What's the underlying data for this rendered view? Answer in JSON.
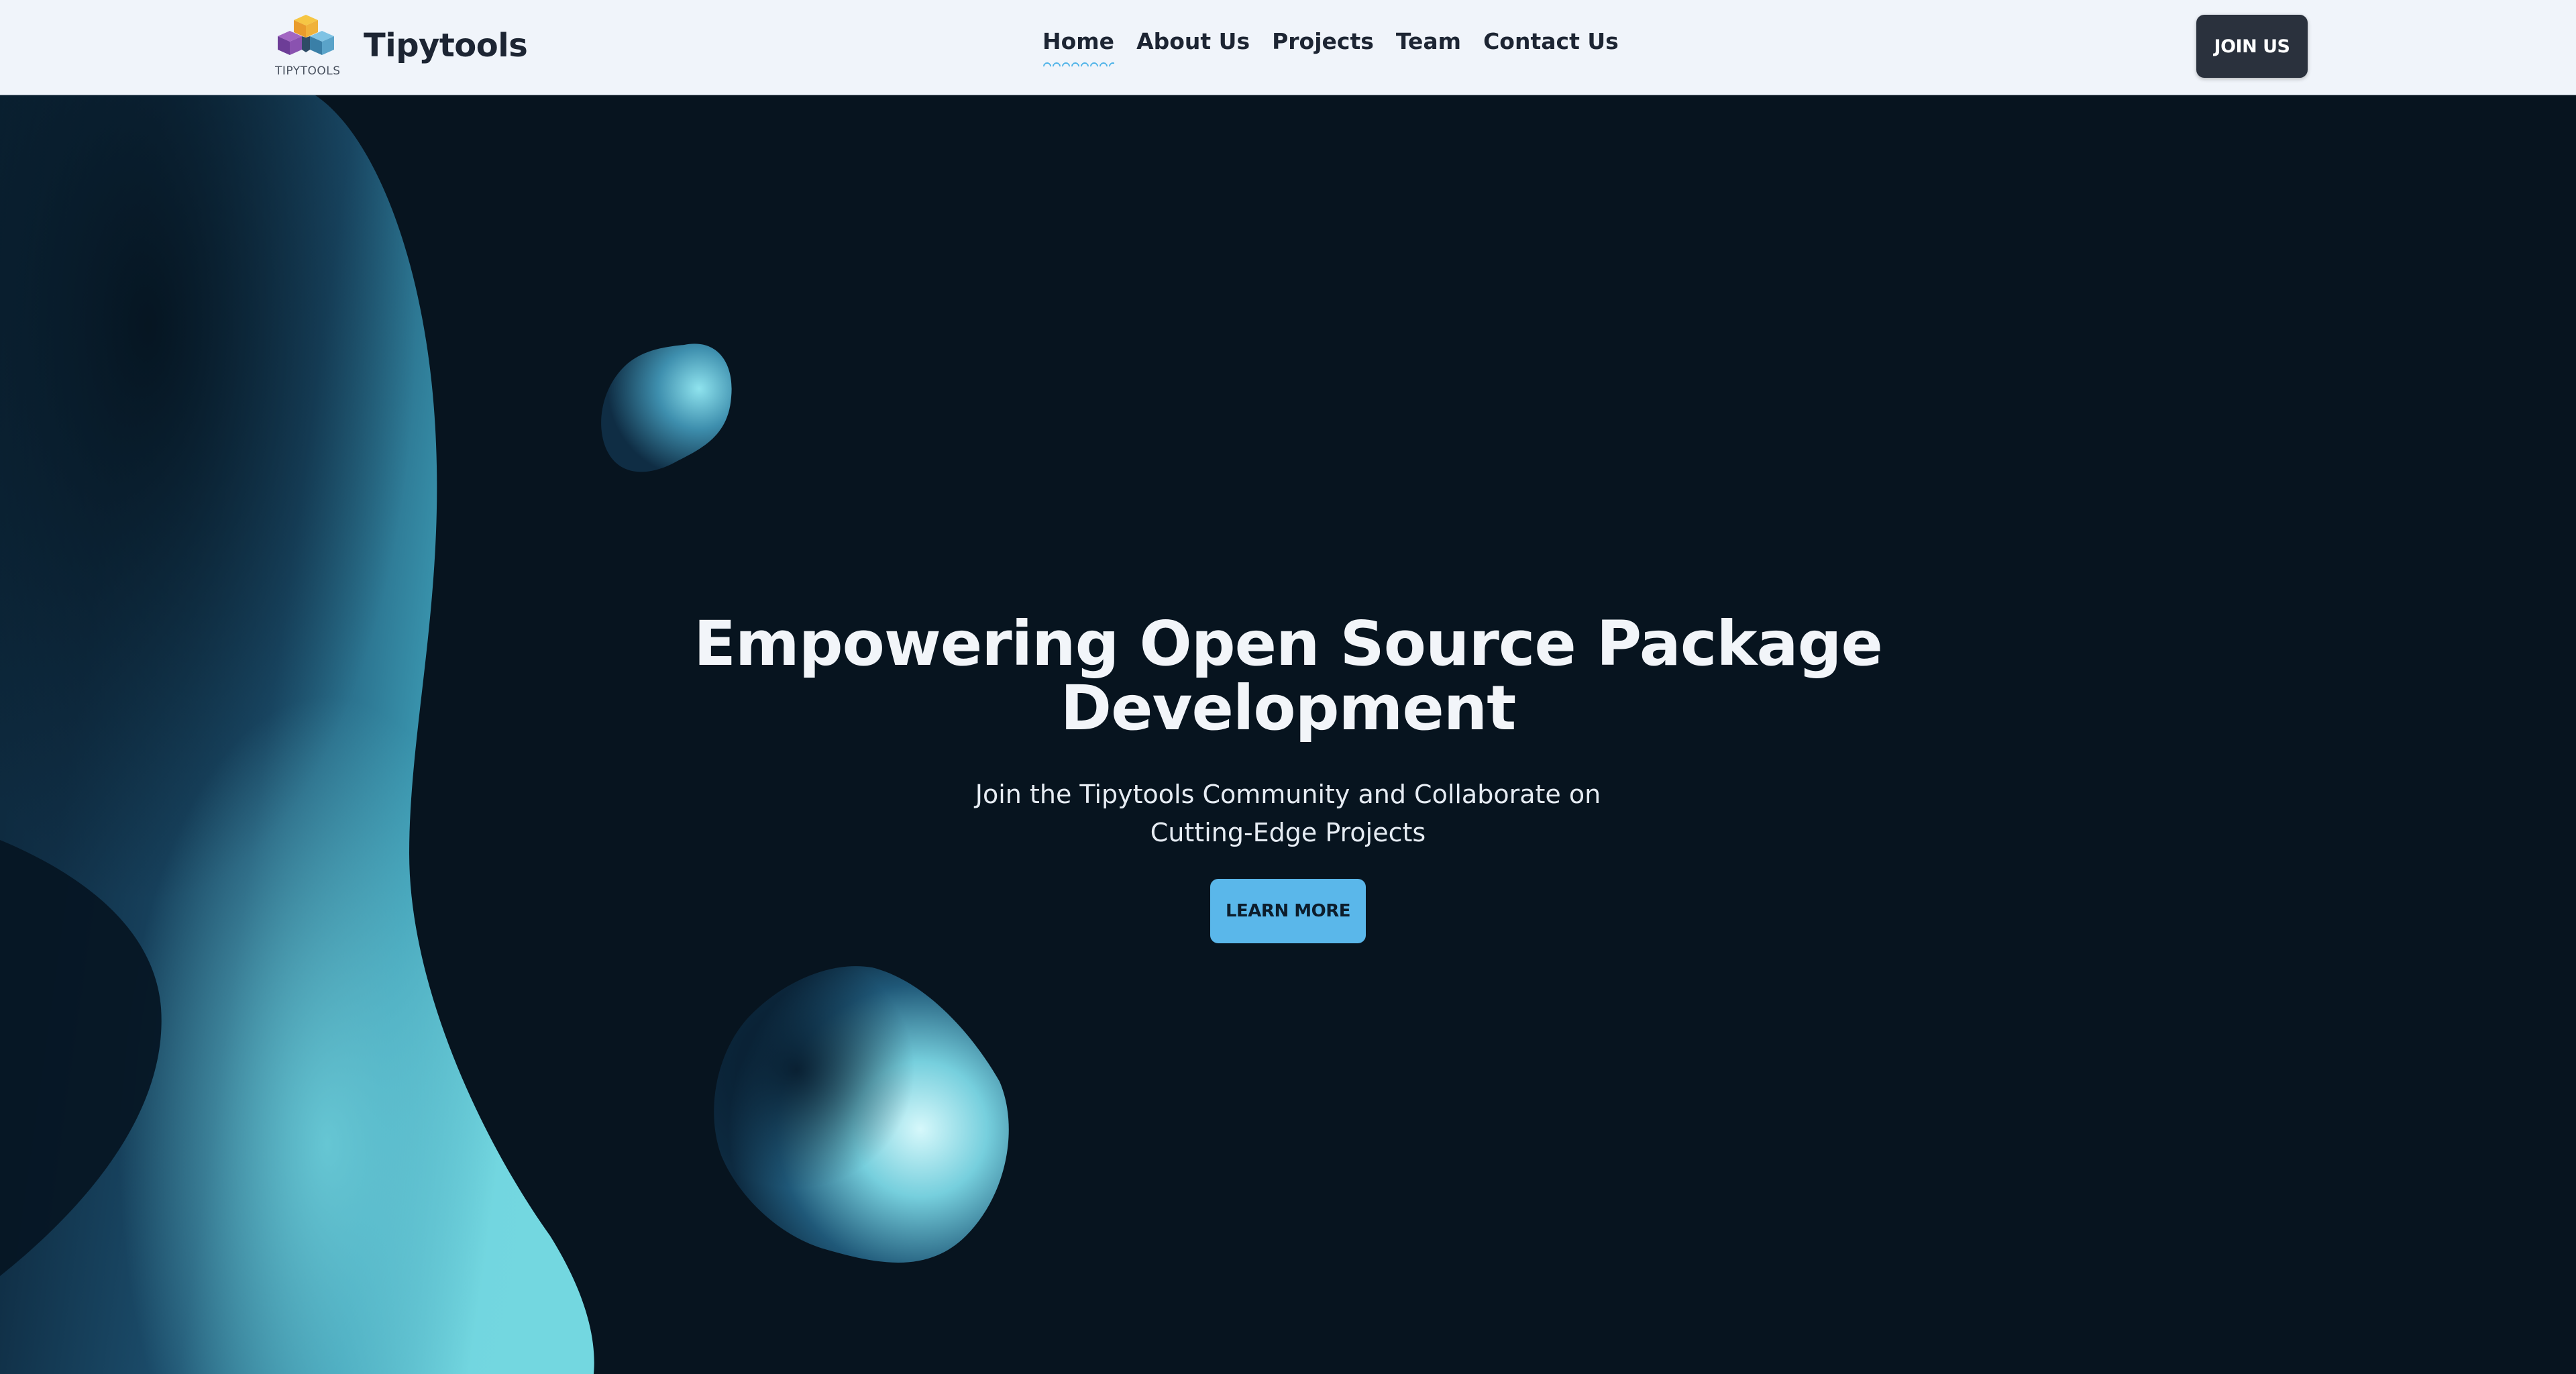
{
  "brand": {
    "name": "Tipytools",
    "logo_caption": "TIPYTOOLS",
    "logo_icon": "stacked-cubes-icon"
  },
  "nav": {
    "items": [
      {
        "label": "Home",
        "active": true
      },
      {
        "label": "About Us",
        "active": false
      },
      {
        "label": "Projects",
        "active": false
      },
      {
        "label": "Team",
        "active": false
      },
      {
        "label": "Contact Us",
        "active": false
      }
    ],
    "cta_label": "JOIN US"
  },
  "hero": {
    "title_line1": "Empowering Open Source Package",
    "title_line2": "Development",
    "subtitle_line1": "Join the Tipytools Community and Collaborate on",
    "subtitle_line2": "Cutting-Edge Projects",
    "cta_label": "LEARN MORE"
  },
  "colors": {
    "navbar_bg": "#f0f4fa",
    "hero_bg": "#07141f",
    "accent": "#5ab7ea",
    "dark_button": "#2a313d",
    "blob_teal": "#6cd4de"
  }
}
